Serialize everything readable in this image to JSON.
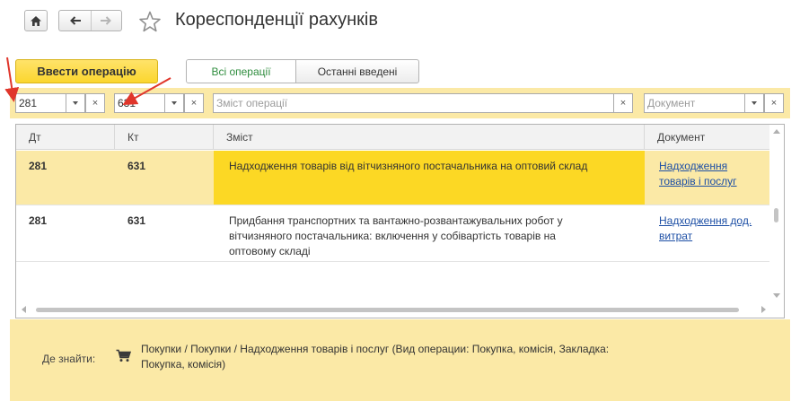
{
  "window": {
    "title": "Кореспонденції рахунків"
  },
  "actions": {
    "enter_operation": "Ввести операцію",
    "tabs": [
      {
        "label": "Всі операції",
        "active": true
      },
      {
        "label": "Останні введені",
        "active": false
      }
    ]
  },
  "filters": {
    "debit_value": "281",
    "credit_value": "631",
    "content_placeholder": "Зміст операції",
    "document_placeholder": "Документ",
    "clear_glyph": "×"
  },
  "table": {
    "columns": [
      "Дт",
      "Кт",
      "Зміст",
      "Документ"
    ],
    "rows": [
      {
        "dt": "281",
        "kt": "631",
        "content": "Надходження товарів від вітчизняного постачальника на оптовий склад",
        "document": "Надходження товарів і послуг",
        "selected": true
      },
      {
        "dt": "281",
        "kt": "631",
        "content": "Придбання транспортних та вантажно-розвантажувальних робот у вітчизняного постачальника: включення у собівартість товарів на оптовому складі",
        "document": "Надходження дод. витрат",
        "selected": false
      }
    ]
  },
  "footer": {
    "where_label": "Де знайти:",
    "path": "Покупки / Покупки / Надходження товарів і послуг (Вид операции: Покупка, комісія, Закладка: Покупка, комісія)"
  },
  "colors": {
    "accent_yellow": "#fcd824",
    "panel_yellow": "#fbe9a6",
    "annotation_red": "#e0362b",
    "link_blue": "#1d4fa5",
    "tab_active_green": "#2f8d3e"
  },
  "icons": {
    "home": "home-icon",
    "back": "arrow-left-icon",
    "forward": "arrow-right-icon",
    "favorite": "star-icon",
    "dropdown": "chevron-down-icon",
    "clear": "close-icon",
    "cart": "cart-icon"
  }
}
